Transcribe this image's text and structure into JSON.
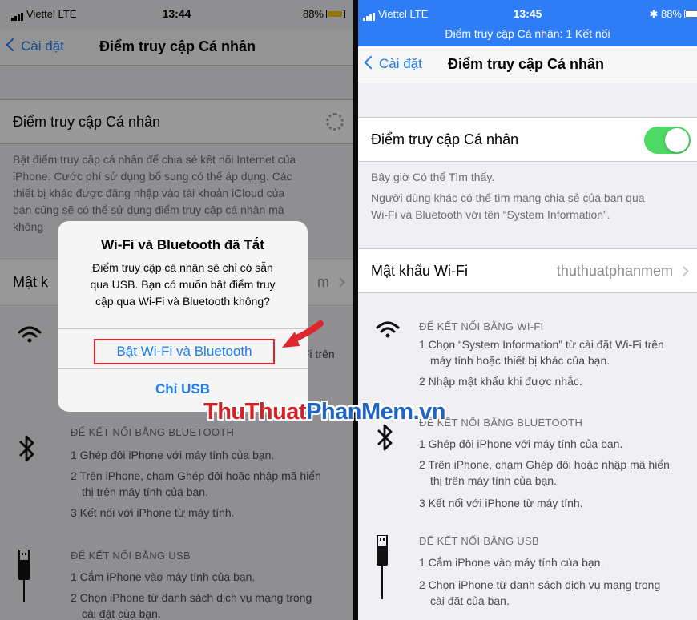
{
  "left": {
    "status": {
      "carrier": "Viettel  LTE",
      "time": "13:44",
      "battery": "88%"
    },
    "nav": {
      "back": "Cài đặt",
      "title": "Điểm truy cập Cá nhân"
    },
    "hotspot_label": "Điểm truy cập Cá nhân",
    "hotspot_footer": [
      "Bật điểm truy cập cá nhân để chia sẻ kết nối Internet của",
      "iPhone. Cước phí sử dụng bổ sung có thể áp dụng. Các",
      "thiết bị khác được đăng nhập vào tài khoản iCloud của",
      "bạn cũng sẽ có thể sử dụng điểm truy cập cá nhân mà",
      "không"
    ],
    "wifi_password_label": "Mật k",
    "wifi_password_value": "m",
    "wifi_step_tail": "Fi trên",
    "bt_header": "ĐỂ KẾT NỐI BẰNG BLUETOOTH",
    "bt_steps": [
      "1 Ghép đôi iPhone với máy tính của bạn.",
      "2 Trên iPhone, chạm Ghép đôi hoặc nhập mã hiển",
      "thị trên máy tính của bạn.",
      "3 Kết nối với iPhone từ máy tính."
    ],
    "usb_header": "ĐỂ KẾT NỐI BẰNG USB",
    "usb_steps": [
      "1 Cắm iPhone vào máy tính của bạn.",
      "2 Chọn iPhone từ danh sách dịch vụ mạng trong",
      "cài đặt của bạn."
    ],
    "alert": {
      "title": "Wi-Fi và Bluetooth đã Tắt",
      "message": [
        "Điểm truy cập cá nhân sẽ chỉ có sẵn",
        "qua USB. Bạn có muốn bật điểm truy",
        "cập qua Wi-Fi và Bluetooth không?"
      ],
      "primary": "Bật Wi-Fi và Bluetooth",
      "secondary": "Chỉ USB"
    }
  },
  "right": {
    "status": {
      "carrier": "Viettel  LTE",
      "time": "13:45",
      "battery": "88%",
      "bluetooth": "✱"
    },
    "hotspot_banner": "Điểm truy cập Cá nhân: 1 Kết nối",
    "nav": {
      "back": "Cài đặt",
      "title": "Điểm truy cập Cá nhân"
    },
    "hotspot_label": "Điểm truy cập Cá nhân",
    "hotspot_on": true,
    "discoverable": "Bây giờ Có thể Tìm thấy.",
    "footer": [
      "Người dùng khác có thể tìm mạng chia sẻ của bạn qua",
      "Wi-Fi và Bluetooth với tên “System Information”."
    ],
    "wifi_password_label": "Mật khẩu Wi-Fi",
    "wifi_password_value": "thuthuatphanmem",
    "wifi_header": "ĐỂ KẾT NỐI BẰNG WI-FI",
    "wifi_steps": [
      "1 Chọn “System Information” từ cài đặt Wi-Fi trên",
      "máy tính hoặc thiết bị khác của bạn.",
      "2 Nhập mật khẩu khi được nhắc."
    ],
    "bt_header": "ĐỂ KẾT NỐI BẰNG BLUETOOTH",
    "bt_steps": [
      "1 Ghép đôi iPhone với máy tính của bạn.",
      "2 Trên iPhone, chạm Ghép đôi hoặc nhập mã hiển",
      "thị trên máy tính của bạn.",
      "3 Kết nối với iPhone từ máy tính."
    ],
    "usb_header": "ĐỂ KẾT NỐI BẰNG USB",
    "usb_steps": [
      "1 Cắm iPhone vào máy tính của bạn.",
      "2 Chọn iPhone từ danh sách dịch vụ mạng trong",
      "cài đặt của bạn."
    ]
  },
  "watermark": {
    "part1": "ThuThuat",
    "part2": "PhanMem",
    "part3": ".vn"
  },
  "colors": {
    "ios_blue": "#1e7cf2",
    "toggle_on": "#4cd964",
    "highlight": "#e0262d",
    "hotspot_banner": "#2f7df6"
  }
}
